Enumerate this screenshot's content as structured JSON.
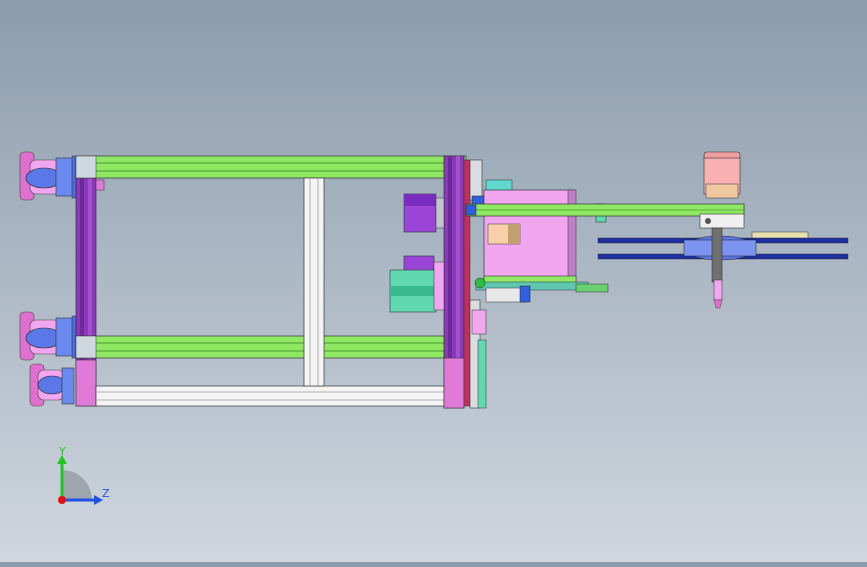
{
  "view": {
    "title": "",
    "background_top": "#8c9cad",
    "background_bottom": "#cfd6de"
  },
  "triad": {
    "y_label": "Y",
    "z_label": "Z",
    "y_color": "#1ec81e",
    "z_color": "#2050e8",
    "x_color": "#e01010"
  },
  "colors": {
    "frame_green": "#8fe864",
    "frame_purple": "#8a3ab8",
    "frame_magenta": "#e07ad8",
    "frame_white": "#f4f4f4",
    "caster_blue": "#6a8af0",
    "caster_pink": "#e070d0",
    "panel_pink": "#f2a6f0",
    "motor_pink": "#f8b0b0",
    "teal": "#60d8b0",
    "blue": "#3060e0",
    "disc_blue": "#5a78e8"
  },
  "components": {
    "label_motor_box_1": "",
    "label_motor_box_2": ""
  }
}
